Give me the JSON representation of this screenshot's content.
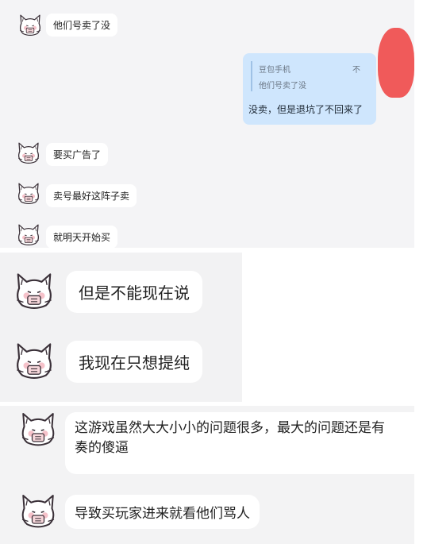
{
  "colors": {
    "panel_bg": "#f4f4f6",
    "bubble_bg": "#ffffff",
    "self_bubble_bg": "#cfe6fd",
    "redaction": "#f05a5a"
  },
  "panel1": {
    "messages": [
      {
        "text": "他们号卖了没"
      },
      {
        "text": "要买广告了"
      },
      {
        "text": "卖号最好这阵子卖"
      },
      {
        "text": "就明天开始买"
      }
    ],
    "self_message": {
      "quote_name": "豆包手机",
      "quote_close": "不",
      "quote_text": "他们号卖了没",
      "text": "没卖，但是退坑了不回来了"
    }
  },
  "panel2": {
    "messages": [
      {
        "text": "但是不能现在说"
      },
      {
        "text": "我现在只想提纯"
      }
    ]
  },
  "panel3": {
    "messages": [
      {
        "line1": "这游戏虽然大大小小的问题很多，最大的问题还是有",
        "line2": "奏的傻逼"
      },
      {
        "text": "导致买玩家进来就看他们骂人"
      }
    ]
  }
}
